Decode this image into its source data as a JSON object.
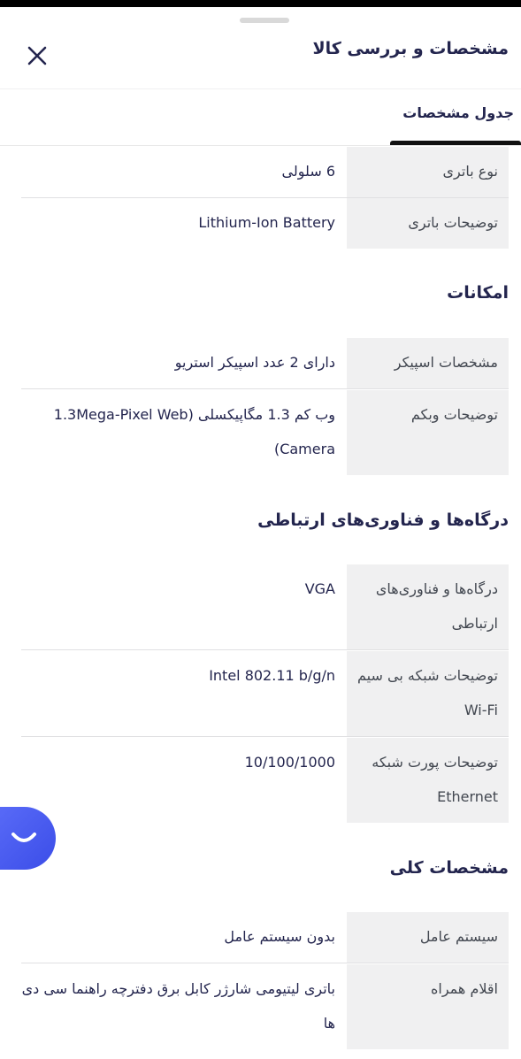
{
  "sheet": {
    "title": "مشخصات و بررسی کالا"
  },
  "tabs": [
    {
      "label": "جدول مشخصات",
      "active": true
    }
  ],
  "rows_battery": [
    {
      "key": "نوع باتری",
      "value": "6 سلولی"
    },
    {
      "key": "توضیحات باتری",
      "value": "Lithium-Ion Battery"
    }
  ],
  "sections": [
    {
      "title": "امکانات",
      "rows": [
        {
          "key": "مشخصات اسپیکر",
          "value": "دارای 2 عدد اسپیکر استریو"
        },
        {
          "key": "توضیحات وبکم",
          "value": "وب کم 1.3 مگاپیکسلی (1.3Mega-Pixel Web Camera)"
        }
      ]
    },
    {
      "title": "درگاه‌ها و فناوری‌های ارتباطی",
      "rows": [
        {
          "key": "درگاه‌ها و فناوری‌های ارتباطی",
          "value": "VGA"
        },
        {
          "key": "توضیحات شبکه بی سیم Wi-Fi",
          "value": "Intel 802.11 b/g/n"
        },
        {
          "key": "توضیحات پورت شبکه Ethernet",
          "value": "10/100/1000"
        }
      ]
    },
    {
      "title": "مشخصات کلی",
      "rows": [
        {
          "key": "سیستم عامل",
          "value": "بدون سیستم عامل"
        },
        {
          "key": "اقلام همراه",
          "value": "باتری لیتیومی شارژر کابل برق دفترچه راهنما سی دی ها"
        }
      ]
    }
  ],
  "colors": {
    "title": "#23254e",
    "key_bg": "#f0f0f1",
    "fab": "#4a5cf0"
  },
  "icons": {
    "close": "close-icon",
    "chat": "chat-smile-icon"
  }
}
